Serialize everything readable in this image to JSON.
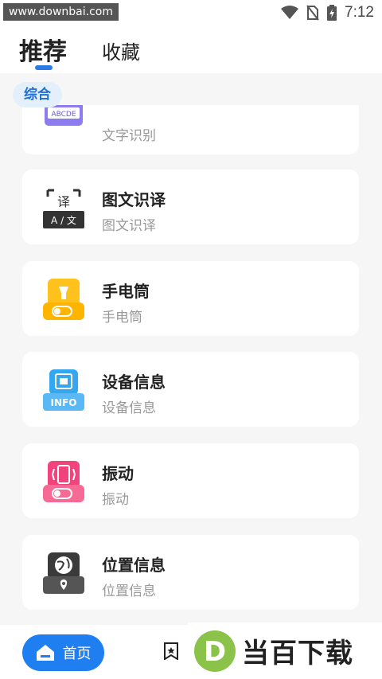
{
  "status_bar": {
    "watermark": "www.downbai.com",
    "time": "7:12"
  },
  "tabs": [
    {
      "label": "推荐"
    },
    {
      "label": "收藏"
    }
  ],
  "category": {
    "label": "综合"
  },
  "tools": [
    {
      "title": "",
      "subtitle": "文字识别",
      "icon_text": "ABCDE"
    },
    {
      "title": "图文识译",
      "subtitle": "图文识译",
      "icon_text": "A / 文"
    },
    {
      "title": "手电筒",
      "subtitle": "手电筒"
    },
    {
      "title": "设备信息",
      "subtitle": "设备信息",
      "icon_text": "INFO"
    },
    {
      "title": "振动",
      "subtitle": "振动"
    },
    {
      "title": "位置信息",
      "subtitle": "位置信息"
    }
  ],
  "bottom_nav": {
    "home_label": "首页",
    "brand_text": "当百下载",
    "brand_letter": "D"
  },
  "colors": {
    "accent": "#1f7ef0",
    "background": "#f6f6f7"
  }
}
